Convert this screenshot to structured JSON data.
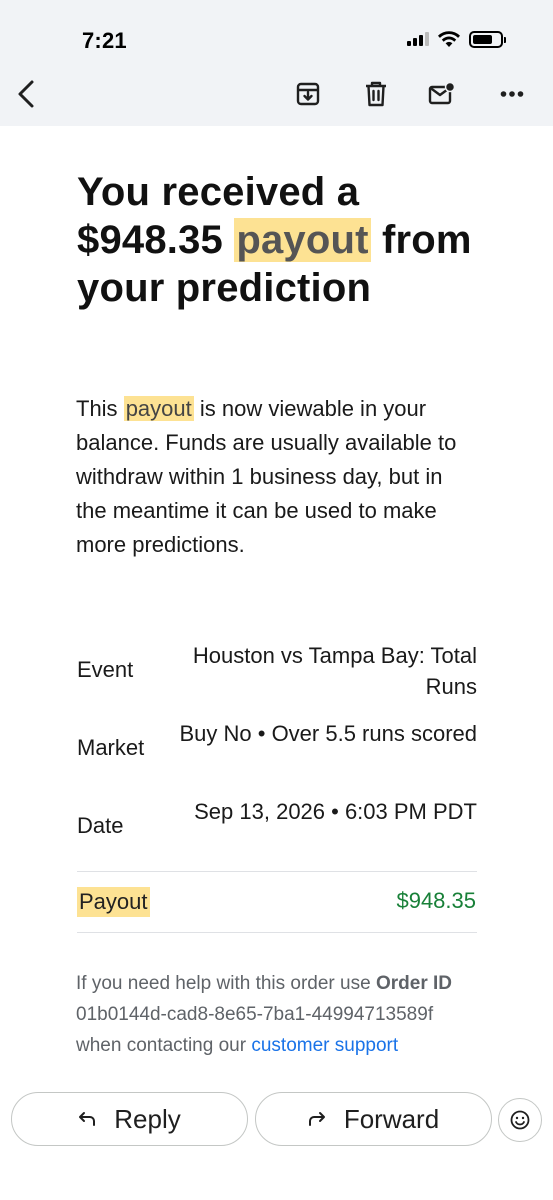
{
  "status": {
    "time": "7:21"
  },
  "toolbar": {
    "back_icon": "chevron-left-icon",
    "archive_icon": "archive-icon",
    "delete_icon": "trash-icon",
    "unread_icon": "mark-unread-icon",
    "more_icon": "more-horizontal-icon"
  },
  "email": {
    "title_part1": "You received a $948.35 ",
    "title_highlight": "payout",
    "title_part2": " from your prediction",
    "intro_part1": "This ",
    "intro_highlight": "payout",
    "intro_part2": " is now viewable in your balance. Funds are usually available to withdraw within 1 business day, but in the meantime it can be used to make more predictions.",
    "details": [
      {
        "label": "Event",
        "value": "Houston vs Tampa Bay: Total Runs"
      },
      {
        "label": "Market",
        "value": "Buy No • Over 5.5 runs scored"
      },
      {
        "label": "Date",
        "value": "Sep 13, 2026 • 6:03 PM PDT"
      }
    ],
    "payout_label": "Payout",
    "payout_value": "$948.35",
    "help_part1": "If you need help with this order use ",
    "help_bold": "Order ID",
    "help_part2": " 01b0144d-cad8-8e65-7ba1-44994713589f when contacting our ",
    "help_link": "customer support"
  },
  "actions": {
    "reply_label": "Reply",
    "forward_label": "Forward",
    "reply_icon": "reply-icon",
    "forward_icon": "forward-icon",
    "emoji_icon": "emoji-reaction-icon"
  },
  "colors": {
    "highlight": "#fde293",
    "payout_green": "#188038",
    "link_blue": "#1a73e8",
    "chrome_bg": "#f1f3f6"
  }
}
